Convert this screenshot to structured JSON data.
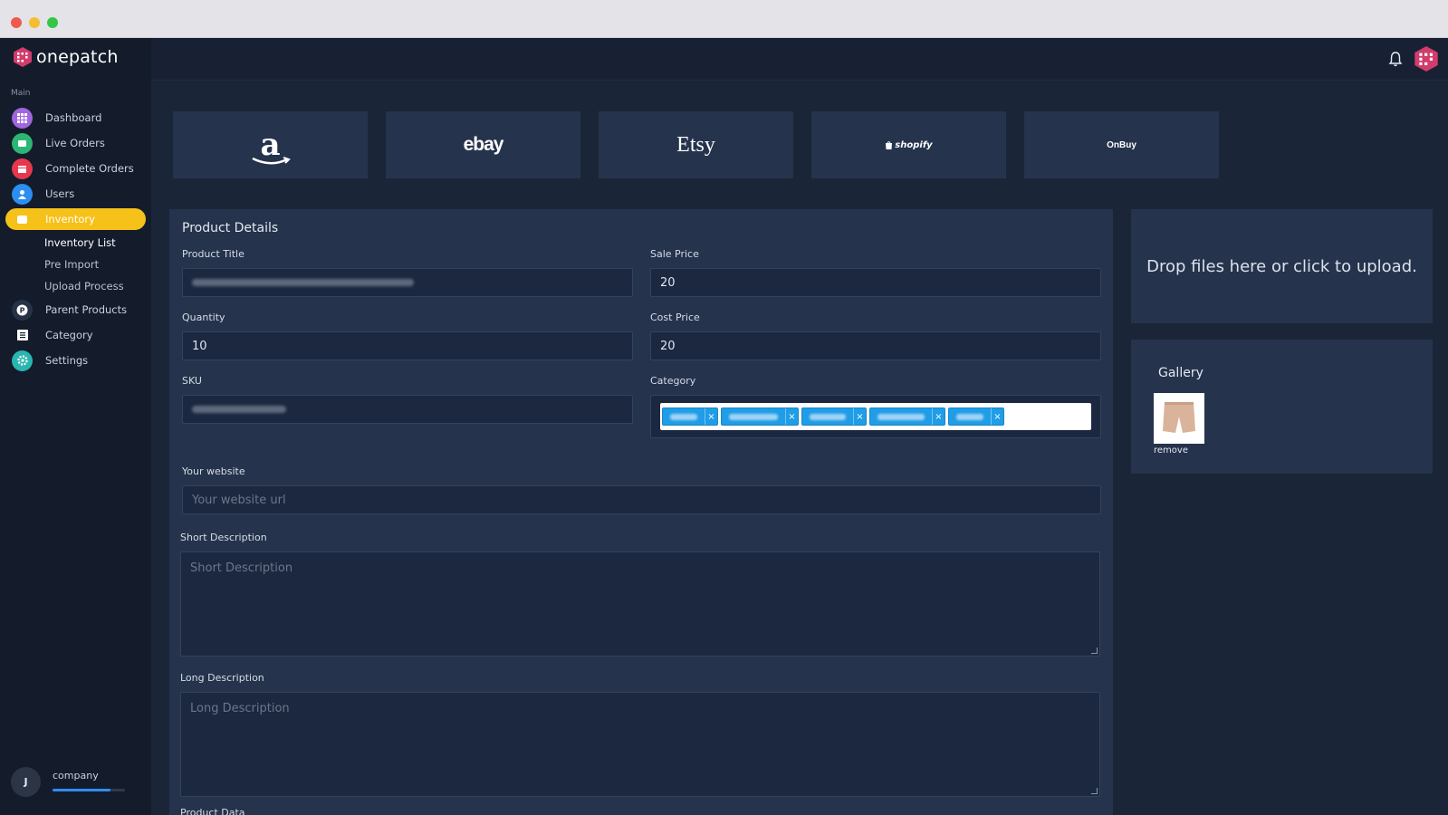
{
  "app": {
    "brand": "onepatch"
  },
  "sidebar": {
    "section_label": "Main",
    "items": [
      {
        "label": "Dashboard",
        "icon": "grid-icon",
        "color": "#a066e0"
      },
      {
        "label": "Live Orders",
        "icon": "cart-icon",
        "color": "#2bb673"
      },
      {
        "label": "Complete Orders",
        "icon": "calendar-icon",
        "color": "#e8374d"
      },
      {
        "label": "Users",
        "icon": "user-icon",
        "color": "#2b8ef0"
      },
      {
        "label": "Inventory",
        "icon": "box-icon",
        "color": "#f6c118",
        "active": true
      },
      {
        "label": "Parent Products",
        "icon": "parent-icon",
        "color": "#1f2b3f"
      },
      {
        "label": "Category",
        "icon": "list-icon",
        "color": "#1f2b3f"
      },
      {
        "label": "Settings",
        "icon": "gear-icon",
        "color": "#29b5b0"
      }
    ],
    "subitems": [
      "Inventory List",
      "Pre Import",
      "Upload Process"
    ],
    "current_subitem": "Inventory List",
    "user": {
      "initial": "J",
      "company": "company",
      "progress": 0.8
    }
  },
  "marketplaces": [
    "a",
    "ebay",
    "Etsy",
    "shopify",
    "OnBuy"
  ],
  "product_details": {
    "title": "Product Details",
    "product_title_label": "Product Title",
    "sale_price_label": "Sale Price",
    "sale_price": "20",
    "quantity_label": "Quantity",
    "quantity": "10",
    "cost_price_label": "Cost Price",
    "cost_price": "20",
    "sku_label": "SKU",
    "category_label": "Category",
    "tag_remove": "×",
    "website_label": "Your website",
    "website_placeholder": "Your website url",
    "short_desc_label": "Short Description",
    "short_desc_placeholder": "Short Description",
    "long_desc_label": "Long Description",
    "long_desc_placeholder": "Long Description",
    "next_label": "Product Data"
  },
  "upload": {
    "dropzone_text": "Drop files here or click to upload."
  },
  "gallery": {
    "title": "Gallery",
    "remove_label": "remove"
  }
}
